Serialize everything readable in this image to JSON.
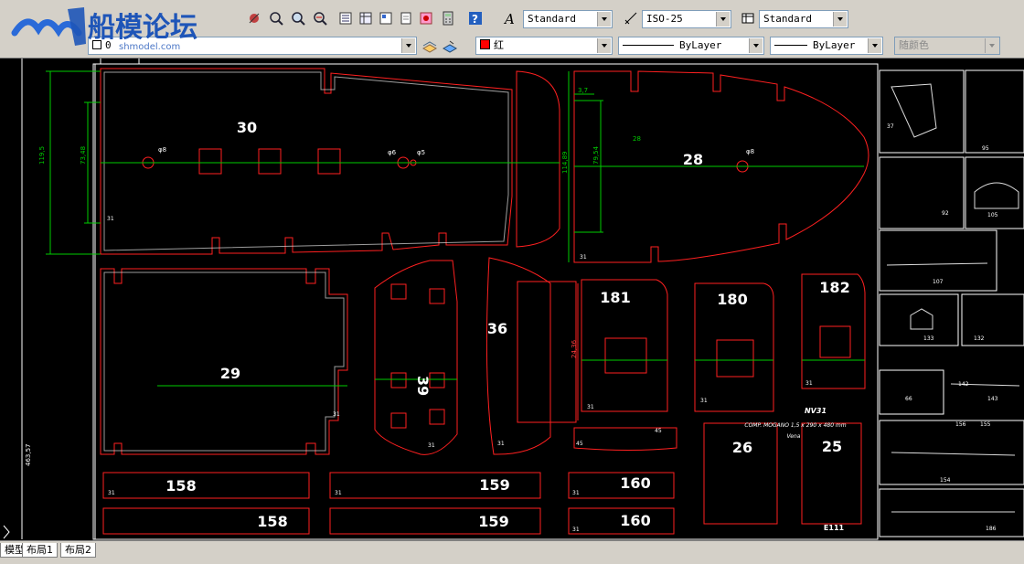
{
  "watermark": {
    "logo_text": "船模论坛",
    "url_text": "shmodel.com"
  },
  "toolbar": {
    "text_style": "Standard",
    "dim_style": "ISO-25",
    "table_style": "Standard"
  },
  "properties": {
    "layer_value": "0",
    "color_value": "红",
    "linetype_value": "ByLayer",
    "lineweight_value": "ByLayer",
    "plotstyle_value": "随颜色"
  },
  "colors": {
    "ui_bg": "#d4d0c8",
    "canvas_bg": "#000000",
    "part_outline": "#ff2020",
    "dimension": "#00cc00",
    "layer_color_swatch": "#ff0000"
  },
  "drawing": {
    "part_labels": [
      "30",
      "28",
      "29",
      "39",
      "36",
      "181",
      "180",
      "182",
      "26",
      "25",
      "158",
      "158",
      "159",
      "159",
      "160",
      "160"
    ],
    "dimension_labels": [
      "119,5",
      "73,48",
      "114,89",
      "79,54",
      "3,7",
      "24,36"
    ],
    "hole_labels": [
      "φ8",
      "φ6",
      "φ5",
      "φ8"
    ],
    "small_marks": [
      "31",
      "31",
      "31",
      "31",
      "31",
      "31",
      "31",
      "31",
      "31",
      "31",
      "31",
      "31",
      "45",
      "45",
      "28"
    ],
    "plate_title": "NV31",
    "plate_note": "COMP. MOGANO 1,5 x 290 x 480 mm",
    "plate_note2": "Vena",
    "stamp": "E111",
    "side_dimension": "463,57",
    "detail_numbers": [
      "37",
      "95",
      "92",
      "105",
      "107",
      "133",
      "132",
      "66",
      "142",
      "143",
      "156",
      "155",
      "154",
      "186"
    ]
  },
  "layout_tabs": {
    "model": "模型",
    "layout1": "布局1",
    "layout2": "布局2"
  }
}
